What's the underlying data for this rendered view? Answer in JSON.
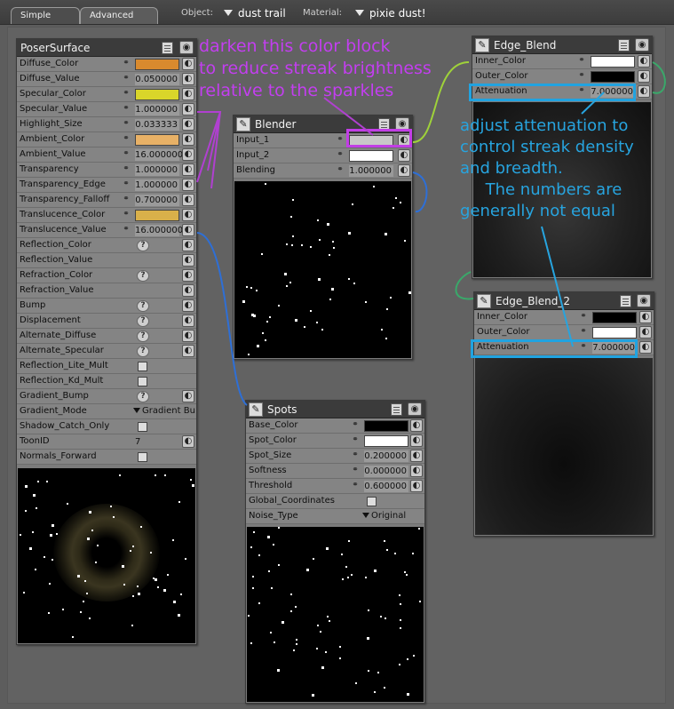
{
  "tabs": [
    {
      "label": "Simple"
    },
    {
      "label": "Advanced"
    }
  ],
  "toolbar": {
    "object_label": "Object:",
    "object_value": "dust trail",
    "material_label": "Material:",
    "material_value": "pixie dust!"
  },
  "poser_surface": {
    "title": "PoserSurface",
    "rows": [
      {
        "label": "Diffuse_Color",
        "kind": "color",
        "color": "#d98a2e"
      },
      {
        "label": "Diffuse_Value",
        "kind": "num",
        "value": "0.050000"
      },
      {
        "label": "Specular_Color",
        "kind": "color",
        "color": "#d9d52a"
      },
      {
        "label": "Specular_Value",
        "kind": "num",
        "value": "1.000000"
      },
      {
        "label": "Highlight_Size",
        "kind": "num",
        "value": "0.033333"
      },
      {
        "label": "Ambient_Color",
        "kind": "color",
        "color": "#e8b166"
      },
      {
        "label": "Ambient_Value",
        "kind": "num",
        "value": "16.000000"
      },
      {
        "label": "Transparency",
        "kind": "num",
        "value": "1.000000"
      },
      {
        "label": "Transparency_Edge",
        "kind": "num",
        "value": "1.000000"
      },
      {
        "label": "Transparency_Falloff",
        "kind": "num",
        "value": "0.700000"
      },
      {
        "label": "Translucence_Color",
        "kind": "color",
        "color": "#d9b04a"
      },
      {
        "label": "Translucence_Value",
        "kind": "num",
        "value": "16.000000"
      },
      {
        "label": "Reflection_Color",
        "kind": "q"
      },
      {
        "label": "Reflection_Value",
        "kind": "plug"
      },
      {
        "label": "Refraction_Color",
        "kind": "q"
      },
      {
        "label": "Refraction_Value",
        "kind": "plug"
      },
      {
        "label": "Bump",
        "kind": "q"
      },
      {
        "label": "Displacement",
        "kind": "q"
      },
      {
        "label": "Alternate_Diffuse",
        "kind": "q"
      },
      {
        "label": "Alternate_Specular",
        "kind": "q"
      },
      {
        "label": "Reflection_Lite_Mult",
        "kind": "cb"
      },
      {
        "label": "Reflection_Kd_Mult",
        "kind": "cb"
      },
      {
        "label": "Gradient_Bump",
        "kind": "q"
      },
      {
        "label": "Gradient_Mode",
        "kind": "dd",
        "value": "Gradient Bu"
      },
      {
        "label": "Shadow_Catch_Only",
        "kind": "cb"
      },
      {
        "label": "ToonID",
        "kind": "text",
        "value": "7"
      },
      {
        "label": "Normals_Forward",
        "kind": "cb"
      }
    ]
  },
  "blender": {
    "title": "Blender",
    "rows": [
      {
        "label": "Input_1",
        "kind": "color",
        "color": "#c8c8c8"
      },
      {
        "label": "Input_2",
        "kind": "color",
        "color": "#ffffff"
      },
      {
        "label": "Blending",
        "kind": "num",
        "value": "1.000000"
      }
    ]
  },
  "edge_blend": {
    "title": "Edge_Blend",
    "rows": [
      {
        "label": "Inner_Color",
        "kind": "color",
        "color": "#ffffff"
      },
      {
        "label": "Outer_Color",
        "kind": "color",
        "color": "#000000"
      },
      {
        "label": "Attenuation",
        "kind": "num",
        "value": "7.000000"
      }
    ]
  },
  "edge_blend_2": {
    "title": "Edge_Blend_2",
    "rows": [
      {
        "label": "Inner_Color",
        "kind": "color",
        "color": "#000000"
      },
      {
        "label": "Outer_Color",
        "kind": "color",
        "color": "#ffffff"
      },
      {
        "label": "Attenuation",
        "kind": "num",
        "value": "7.000000"
      }
    ]
  },
  "spots": {
    "title": "Spots",
    "rows": [
      {
        "label": "Base_Color",
        "kind": "color",
        "color": "#000000"
      },
      {
        "label": "Spot_Color",
        "kind": "color",
        "color": "#ffffff"
      },
      {
        "label": "Spot_Size",
        "kind": "num",
        "value": "0.200000"
      },
      {
        "label": "Softness",
        "kind": "num",
        "value": "0.000000"
      },
      {
        "label": "Threshold",
        "kind": "num",
        "value": "0.600000"
      },
      {
        "label": "Global_Coordinates",
        "kind": "cb"
      },
      {
        "label": "Noise_Type",
        "kind": "dd",
        "value": "Original"
      }
    ]
  },
  "annotations": {
    "purple": "darken this color block\nto reduce streak brightness\nrelative to the sparkles",
    "blue": "adjust attenuation to\ncontrol streak density\nand breadth.\n     The numbers are\ngenerally not equal"
  },
  "colors": {
    "annotation_purple": "#c33ef0",
    "annotation_blue": "#27a4df",
    "wire_green": "#9fd23a",
    "wire_blue": "#2e6fd6",
    "wire_purple": "#b040d0"
  },
  "icons": {
    "node_icon": "node-wrench-icon",
    "doc": "options-menu-icon",
    "eye": "preview-eye-icon",
    "link": "link-chain-icon",
    "plug": "input-plug-icon",
    "question": "help-question-icon"
  }
}
